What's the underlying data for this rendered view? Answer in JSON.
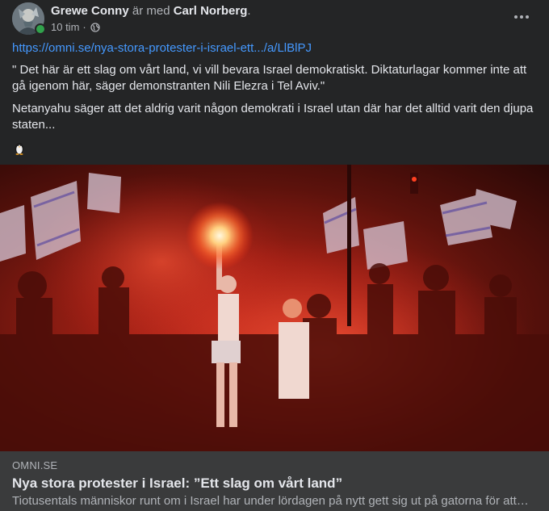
{
  "header": {
    "author": "Grewe Conny",
    "connector": "är med",
    "tagged": "Carl Norberg",
    "period": ".",
    "time": "10 tim",
    "separator": "·",
    "audience_icon": "globe-icon",
    "more_icon": "more-options-icon"
  },
  "post": {
    "link": "https://omni.se/nya-stora-protester-i-israel-ett.../a/LlBlPJ",
    "quote": "\" Det här är ett slag om vårt land, vi vill bevara Israel demokratiskt. Diktaturlagar kommer inte att gå igenom här, säger demonstranten Nili Elezra i Tel Aviv.\"",
    "comment": "Netanyahu säger att det aldrig varit någon demokrati i Israel utan där har det alltid varit den djupa staten...",
    "emoji_icon": "penguin-emoji-icon"
  },
  "preview": {
    "image_icon": "protest-photo",
    "domain": "OMNI.SE",
    "title": "Nya stora protester i Israel: ”Ett slag om vårt land”",
    "description": "Tiotusentals människor runt om i Israel har under lördagen på nytt gett sig ut på gatorna för att protestera mot regeringens kontroversiella rättsreform."
  },
  "colors": {
    "background": "#242526",
    "text": "#e4e6eb",
    "secondary": "#b0b3b8",
    "link": "#4599ff",
    "preview_bg": "#3a3b3c",
    "online": "#31a24c"
  }
}
